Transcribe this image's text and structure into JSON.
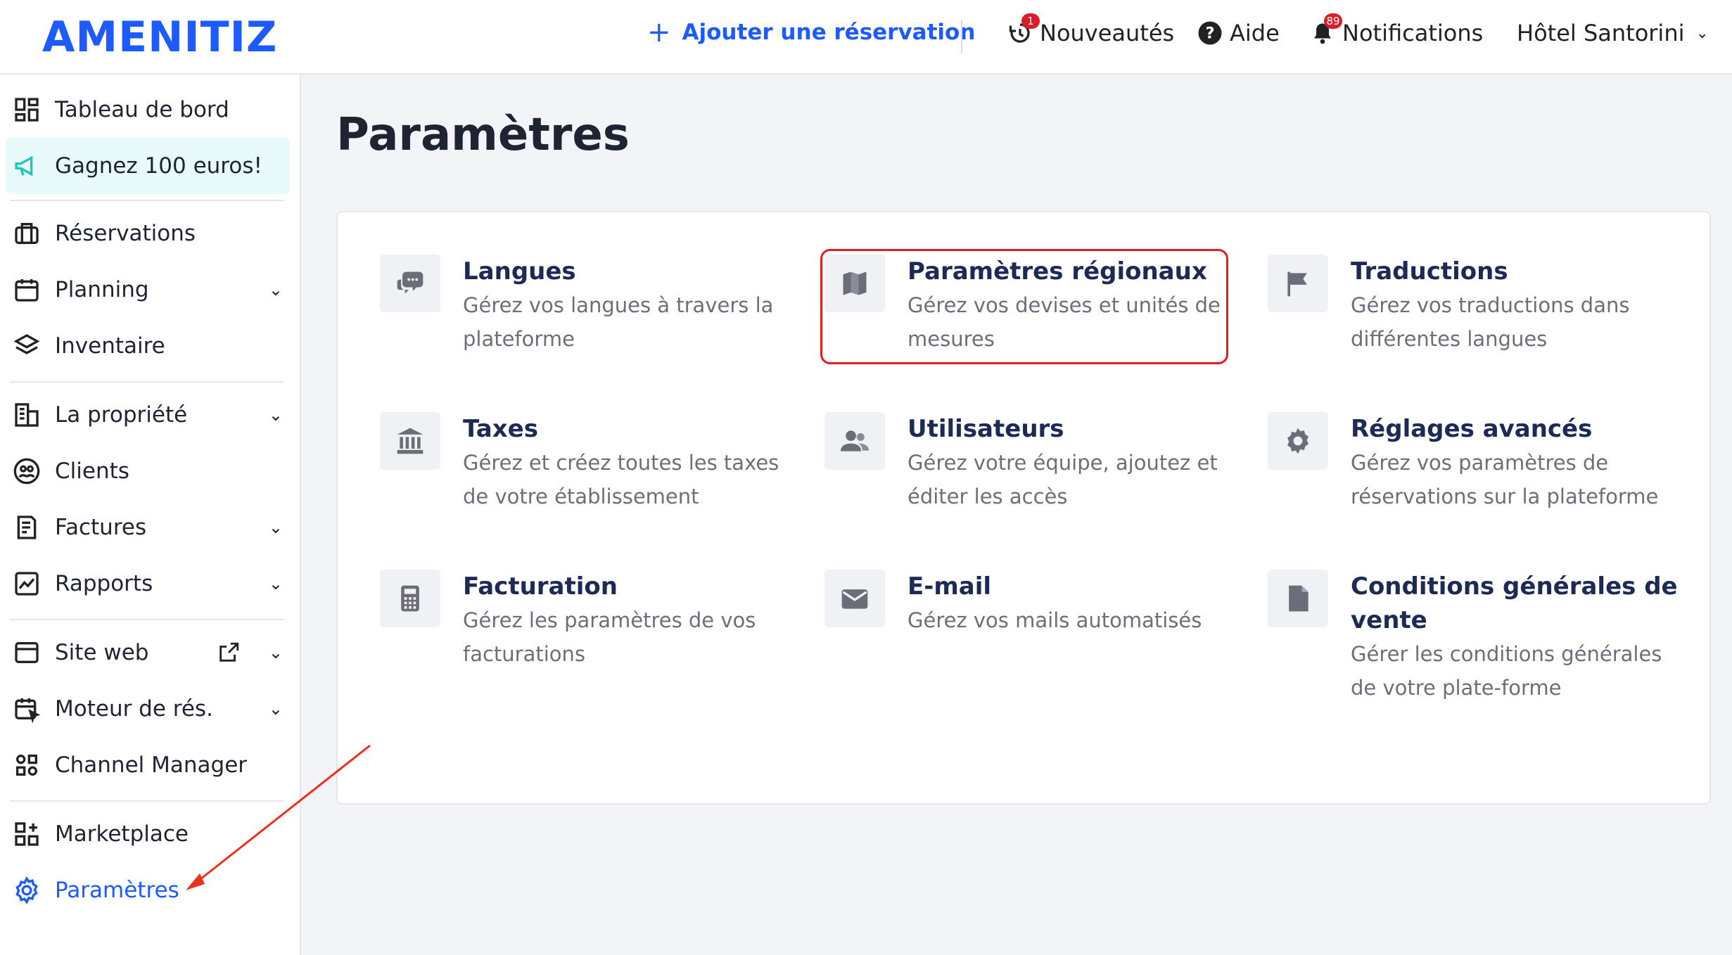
{
  "header": {
    "logo": "AMENITIZ",
    "add_reservation": "Ajouter une réservation",
    "news": {
      "label": "Nouveautés",
      "badge": "1"
    },
    "help": {
      "label": "Aide"
    },
    "notifications": {
      "label": "Notifications",
      "badge": "89"
    },
    "hotel": {
      "label": "Hôtel Santorini"
    }
  },
  "sidebar": {
    "items": [
      {
        "label": "Tableau de bord",
        "icon": "dashboard-icon"
      },
      {
        "label": "Gagnez 100 euros!",
        "icon": "megaphone-icon"
      },
      {
        "label": "Réservations",
        "icon": "suitcase-icon"
      },
      {
        "label": "Planning",
        "icon": "calendar-icon"
      },
      {
        "label": "Inventaire",
        "icon": "layers-icon"
      },
      {
        "label": "La propriété",
        "icon": "building-icon"
      },
      {
        "label": "Clients",
        "icon": "users-circle-icon"
      },
      {
        "label": "Factures",
        "icon": "invoice-icon"
      },
      {
        "label": "Rapports",
        "icon": "chart-icon"
      },
      {
        "label": "Site web",
        "icon": "browser-icon"
      },
      {
        "label": "Moteur de rés.",
        "icon": "calendar-cursor-icon"
      },
      {
        "label": "Channel Manager",
        "icon": "channel-icon"
      },
      {
        "label": "Marketplace",
        "icon": "grid-plus-icon"
      },
      {
        "label": "Paramètres",
        "icon": "gear-icon"
      }
    ]
  },
  "main": {
    "title": "Paramètres",
    "tiles": [
      {
        "title": "Langues",
        "desc1": "Gérez vos langues à travers la",
        "desc2": "plateforme",
        "icon": "chat-bubbles-icon"
      },
      {
        "title": "Paramètres régionaux",
        "desc1": "Gérez vos devises et unités de",
        "desc2": "mesures",
        "icon": "map-icon"
      },
      {
        "title": "Traductions",
        "desc1": "Gérez vos traductions dans",
        "desc2": "différentes langues",
        "icon": "flag-icon"
      },
      {
        "title": "Taxes",
        "desc1": "Gérez et créez toutes les taxes",
        "desc2": "de votre établissement",
        "icon": "bank-icon"
      },
      {
        "title": "Utilisateurs",
        "desc1": "Gérez votre équipe, ajoutez et",
        "desc2": "éditer les accès",
        "icon": "users-icon"
      },
      {
        "title": "Réglages avancés",
        "desc1": "Gérez vos paramètres de",
        "desc2": "réservations sur la plateforme",
        "icon": "cog-icon"
      },
      {
        "title": "Facturation",
        "desc1": "Gérez les paramètres de vos",
        "desc2": "facturations",
        "icon": "calculator-icon"
      },
      {
        "title": "E-mail",
        "desc1": "Gérez vos mails automatisés",
        "desc2": "",
        "icon": "envelope-icon"
      },
      {
        "title1": "Conditions générales de",
        "title2": "vente",
        "desc1": "Gérer les conditions générales",
        "desc2": "de votre plate-forme",
        "icon": "document-icon"
      }
    ]
  },
  "colors": {
    "accent": "#1e5bff",
    "highlight_box": "#e01e1e",
    "promo_bg": "#e8fbfa",
    "tile_title": "#1c2a55"
  }
}
